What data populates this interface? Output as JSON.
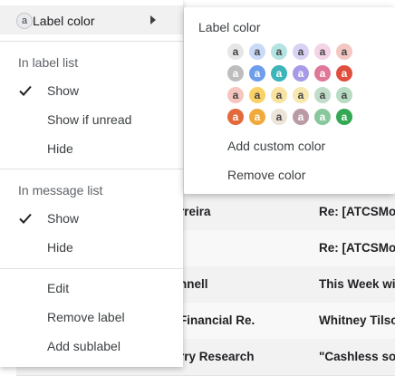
{
  "mail_list": {
    "rows": [
      {
        "sender": "rreira",
        "subject": "Re: [ATCSMo"
      },
      {
        "sender": "",
        "subject": "Re: [ATCSMo"
      },
      {
        "sender": "nnell",
        "subject": "This Week wi"
      },
      {
        "sender": "Financial Re.",
        "subject": "Whitney Tilso"
      },
      {
        "sender": "rry Research",
        "subject": "\"Cashless so"
      }
    ]
  },
  "menu": {
    "label_color": "Label color",
    "avatar_letter": "a",
    "in_label_list": "In label list",
    "label_list_options": [
      "Show",
      "Show if unread",
      "Hide"
    ],
    "in_message_list": "In message list",
    "message_list_options": [
      "Show",
      "Hide"
    ],
    "actions": [
      "Edit",
      "Remove label",
      "Add sublabel"
    ]
  },
  "color_panel": {
    "title": "Label color",
    "swatch_letter": "a",
    "swatches": [
      [
        "#e6e6e6",
        "#c9daf8",
        "#b4e3e2",
        "#d9d2f5",
        "#f3d3e4",
        "#f4c7c3"
      ],
      [
        "#bdbdbd",
        "#6d9eeb",
        "#3cb4b8",
        "#a79be8",
        "#e07798",
        "#e04f3e"
      ],
      [
        "#f6c5be",
        "#fad165",
        "#f9e3a0",
        "#f7e8b0",
        "#c1dcc8",
        "#b6dcc2"
      ],
      [
        "#e3693b",
        "#f2a93b",
        "#ede4d8",
        "#b99aa5",
        "#89c79c",
        "#34a853"
      ]
    ],
    "swatch_text_colors": [
      [
        "#444444",
        "#444444",
        "#444444",
        "#444444",
        "#444444",
        "#444444"
      ],
      [
        "#ffffff",
        "#ffffff",
        "#ffffff",
        "#ffffff",
        "#ffffff",
        "#ffffff"
      ],
      [
        "#444444",
        "#444444",
        "#444444",
        "#444444",
        "#444444",
        "#444444"
      ],
      [
        "#ffffff",
        "#ffffff",
        "#444444",
        "#ffffff",
        "#ffffff",
        "#ffffff"
      ]
    ],
    "add_custom": "Add custom color",
    "remove": "Remove color"
  }
}
